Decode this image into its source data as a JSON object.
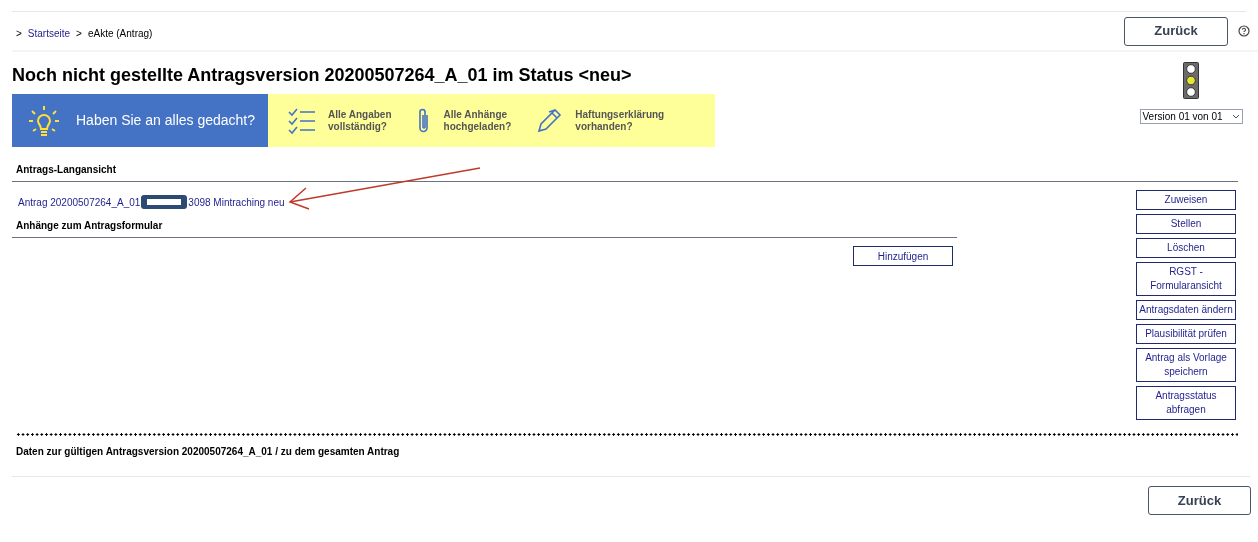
{
  "breadcrumb": [
    {
      "separator": ">",
      "label": "Startseite",
      "link": true
    },
    {
      "separator": ">",
      "label": "eAkte (Antrag)",
      "link": false
    }
  ],
  "back_button": "Zurück",
  "title": "Noch nicht gestellte Antragsversion 20200507264_A_01 im Status <neu>",
  "traffic_light": {
    "red": false,
    "yellow": true,
    "green": false
  },
  "version_select": {
    "value": "Version 01 von 01"
  },
  "checklist_banner": {
    "headline": "Haben Sie an alles gedacht?",
    "items": [
      {
        "kind": "checklist",
        "text": "Alle Angaben\nvollständig?"
      },
      {
        "kind": "attachment",
        "text": "Alle Anhänge\nhochgeladen?"
      },
      {
        "kind": "pen",
        "text": "Haftungserklärung\nvorhanden?"
      }
    ]
  },
  "long_view": {
    "heading": "Antrags-Langansicht",
    "link_before": "Antrag 20200507264_A_01",
    "link_after": "3098 Mintraching neu"
  },
  "attachments": {
    "heading": "Anhänge zum Antragsformular",
    "add_button": "Hinzufügen"
  },
  "actions": [
    "Zuweisen",
    "Stellen",
    "Löschen",
    "RGST -\nFormularansicht",
    "Antragsdaten ändern",
    "Plausibilität prüfen",
    "Antrag als Vorlage\nspeichern",
    "Antragsstatus\nabfragen"
  ],
  "footer": {
    "text": "Daten zur gültigen Antragsversion 20200507264_A_01 / zu dem gesamten Antrag",
    "back_button": "Zurück"
  }
}
